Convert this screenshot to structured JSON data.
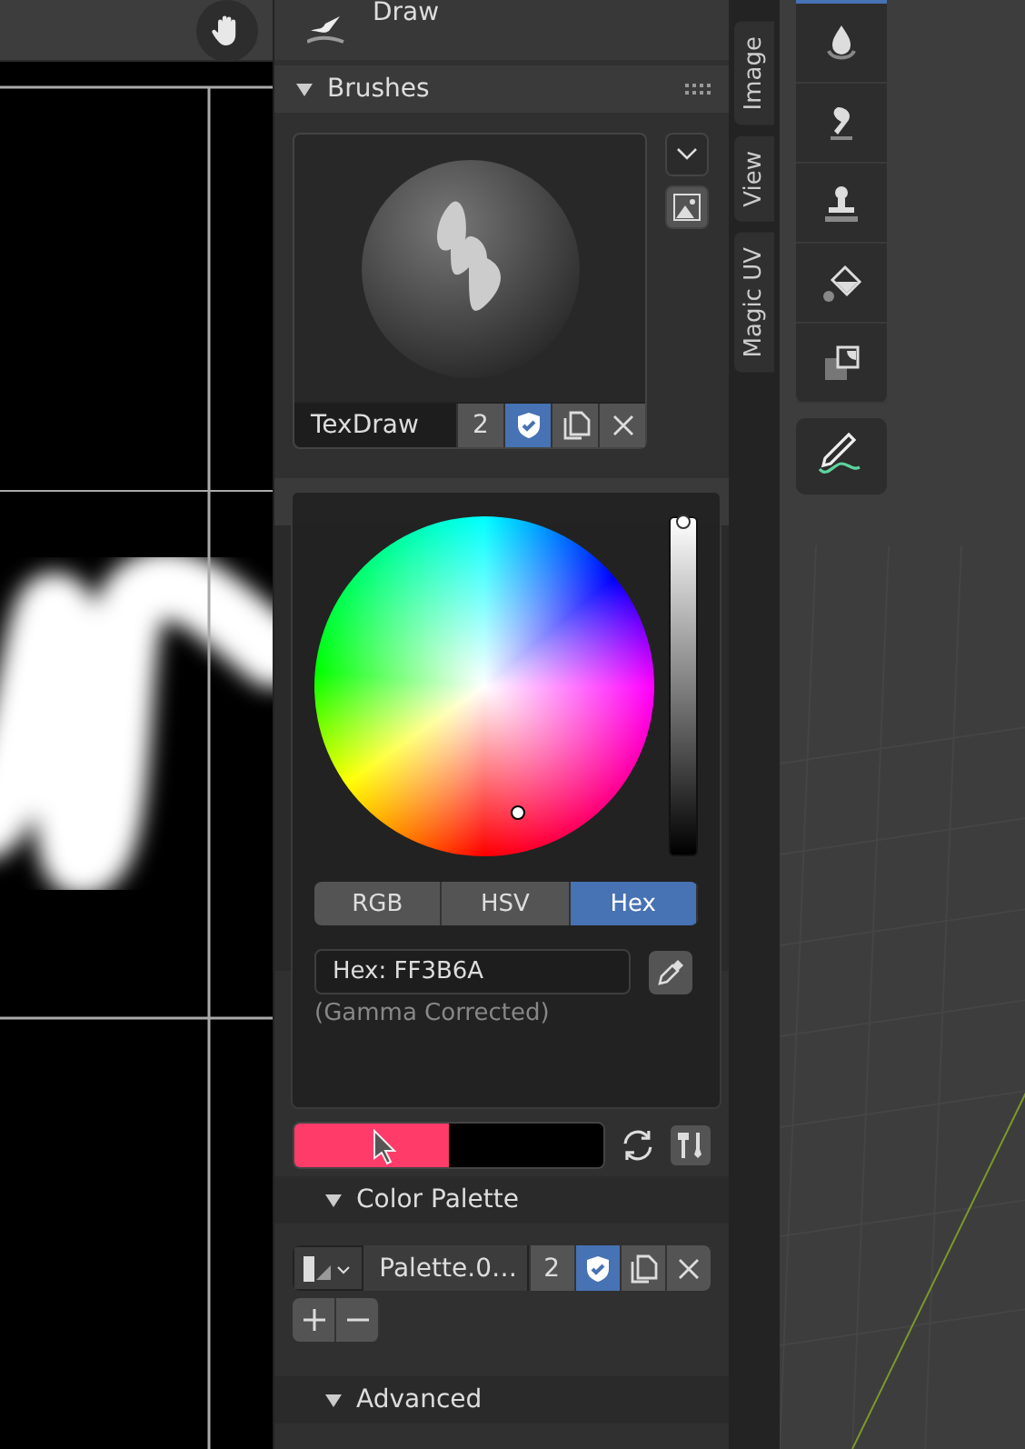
{
  "tool_header": {
    "title": "Draw"
  },
  "brushes": {
    "title": "Brushes",
    "expanded": true,
    "brush_name": "TexDraw",
    "users": "2",
    "fake_user": true
  },
  "color_picker": {
    "modes": [
      {
        "label": "RGB",
        "selected": false
      },
      {
        "label": "HSV",
        "selected": false
      },
      {
        "label": "Hex",
        "selected": true
      }
    ],
    "hex_field": "Hex: FF3B6A",
    "note": "(Gamma Corrected)",
    "level": 1
  },
  "swatches": [
    {
      "color": "#ff3b6a"
    },
    {
      "color": "#000000"
    }
  ],
  "color_palette": {
    "title": "Color Palette",
    "expanded": true,
    "name": "Palette.0…",
    "users": "2",
    "fake_user": true
  },
  "advanced": {
    "title": "Advanced",
    "expanded": true
  },
  "sidebar_tabs": [
    {
      "label": "Image"
    },
    {
      "label": "View"
    },
    {
      "label": "Magic UV"
    }
  ]
}
